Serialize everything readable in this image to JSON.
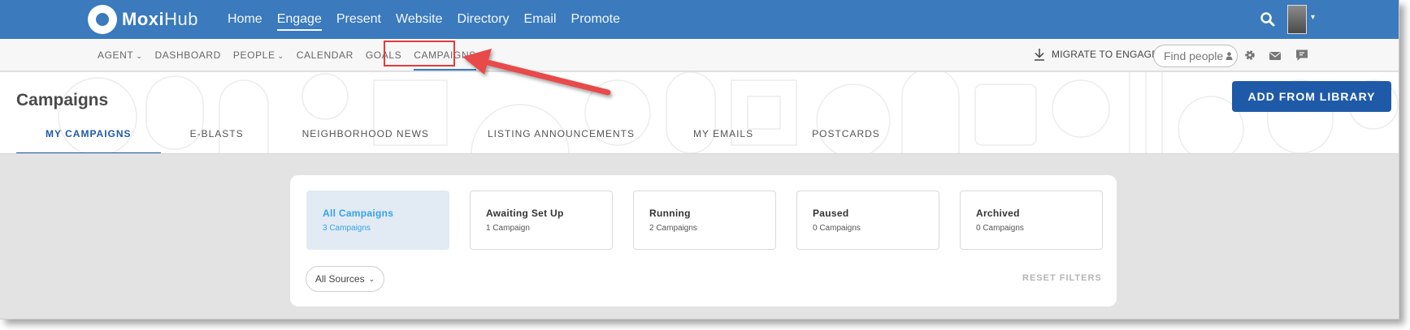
{
  "app": {
    "logo_text_bold": "Moxi",
    "logo_text_light": "Hub"
  },
  "main_nav": [
    {
      "label": "Home",
      "active": false
    },
    {
      "label": "Engage",
      "active": true
    },
    {
      "label": "Present",
      "active": false
    },
    {
      "label": "Website",
      "active": false
    },
    {
      "label": "Directory",
      "active": false
    },
    {
      "label": "Email",
      "active": false
    },
    {
      "label": "Promote",
      "active": false
    }
  ],
  "sub_nav": [
    {
      "label": "AGENT",
      "has_caret": true
    },
    {
      "label": "DASHBOARD",
      "has_caret": false
    },
    {
      "label": "PEOPLE",
      "has_caret": true
    },
    {
      "label": "CALENDAR",
      "has_caret": false
    },
    {
      "label": "GOALS",
      "has_caret": false
    },
    {
      "label": "CAMPAIGNS",
      "has_caret": false,
      "active": true
    }
  ],
  "toolbar": {
    "migrate_label": "MIGRATE TO ENGAGE",
    "find_people_placeholder": "Find people"
  },
  "page": {
    "title": "Campaigns",
    "add_button": "ADD FROM LIBRARY"
  },
  "tabs": [
    {
      "label": "MY CAMPAIGNS",
      "active": true
    },
    {
      "label": "E-BLASTS",
      "active": false
    },
    {
      "label": "NEIGHBORHOOD NEWS",
      "active": false
    },
    {
      "label": "LISTING ANNOUNCEMENTS",
      "active": false
    },
    {
      "label": "MY EMAILS",
      "active": false
    },
    {
      "label": "POSTCARDS",
      "active": false
    }
  ],
  "status_filters": [
    {
      "title": "All Campaigns",
      "count": "3 Campaigns",
      "active": true
    },
    {
      "title": "Awaiting Set Up",
      "count": "1 Campaign",
      "active": false
    },
    {
      "title": "Running",
      "count": "2 Campaigns",
      "active": false
    },
    {
      "title": "Paused",
      "count": "0 Campaigns",
      "active": false
    },
    {
      "title": "Archived",
      "count": "0 Campaigns",
      "active": false
    }
  ],
  "filters": {
    "sources_label": "All Sources",
    "reset_label": "RESET FILTERS"
  },
  "colors": {
    "brand_blue": "#3a7abd",
    "button_blue": "#1f5aa8",
    "active_card_bg": "#e2eaf4",
    "active_card_text": "#34a3e6",
    "annotation_red": "#e23b3b"
  },
  "icons": [
    "search-icon",
    "avatar",
    "download-icon",
    "person-icon",
    "gear-icon",
    "mail-icon",
    "chat-icon",
    "chevron-down-icon"
  ]
}
